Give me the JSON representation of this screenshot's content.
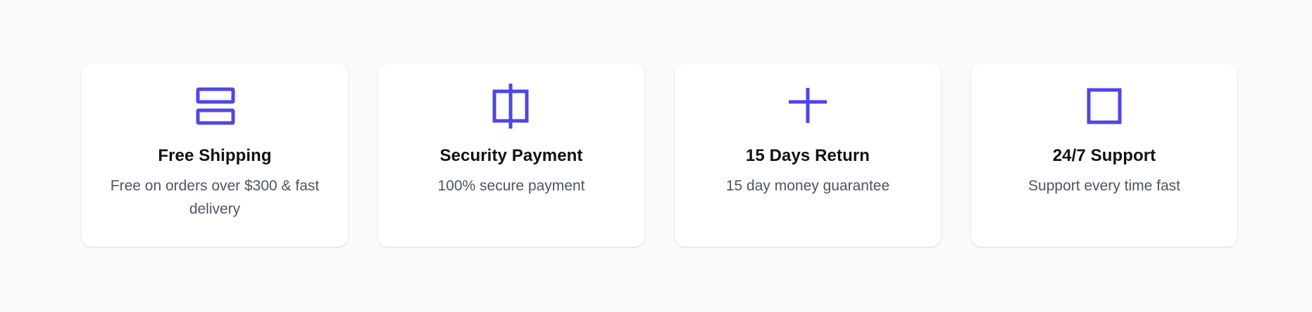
{
  "colors": {
    "accent": "#4f46e5",
    "background": "#f9fafb",
    "card": "#ffffff",
    "title": "#111111",
    "description": "#4b5563"
  },
  "features": [
    {
      "icon": "server-icon",
      "title": "Free Shipping",
      "description": "Free on orders over $300 & fast delivery"
    },
    {
      "icon": "split-square-icon",
      "title": "Security Payment",
      "description": "100% secure payment"
    },
    {
      "icon": "plus-icon",
      "title": "15 Days Return",
      "description": "15 day money guarantee"
    },
    {
      "icon": "square-icon",
      "title": "24/7 Support",
      "description": "Support every time fast"
    }
  ]
}
